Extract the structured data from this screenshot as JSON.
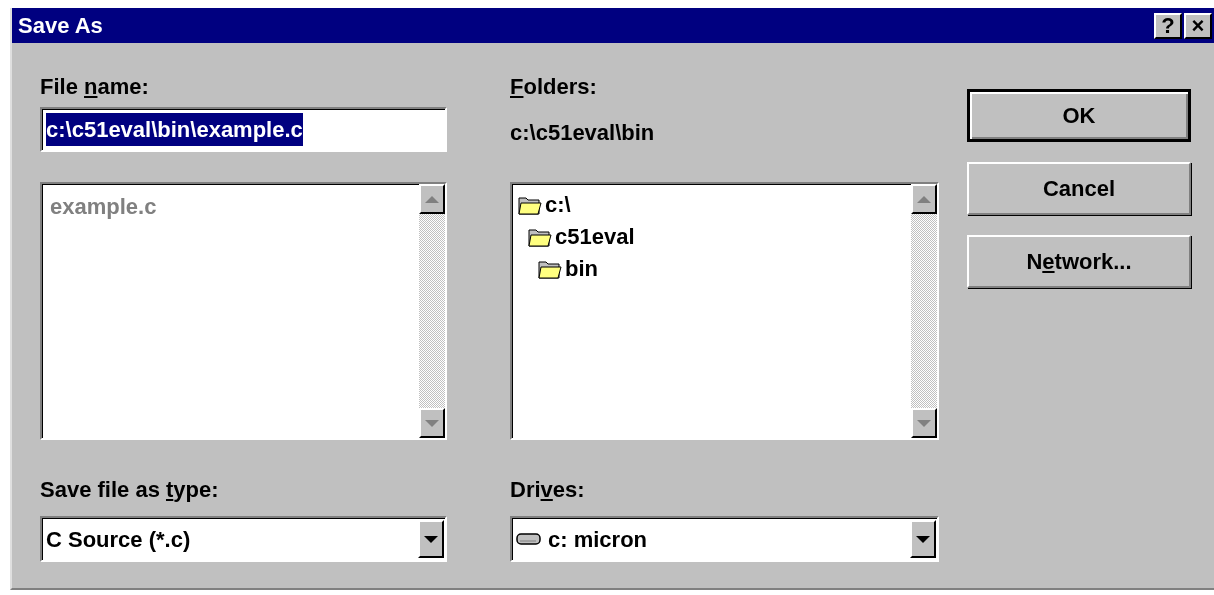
{
  "window": {
    "title": "Save As",
    "title_buttons": [
      "?",
      "×"
    ]
  },
  "file_name": {
    "label": {
      "before": "File ",
      "key": "n",
      "after": "ame:"
    },
    "value": "c:\\c51eval\\bin\\example.c",
    "value_selected": true
  },
  "file_list": {
    "items": [
      {
        "text": "example.c",
        "disabled": true
      }
    ]
  },
  "folders": {
    "label": {
      "key": "F",
      "after": "olders:"
    },
    "path": "c:\\c51eval\\bin",
    "tree": [
      {
        "name": "c:\\",
        "children": [
          {
            "name": "c51eval",
            "children": [
              {
                "name": "bin"
              }
            ]
          }
        ]
      }
    ]
  },
  "save_type": {
    "label": {
      "before": "Save file as ",
      "key": "t",
      "after": "ype:"
    },
    "value": "C Source (*.c)"
  },
  "drives": {
    "label": {
      "before": "Dri",
      "key": "v",
      "after": "es:"
    },
    "value": "c: micron"
  },
  "buttons": [
    {
      "label": {
        "before": "OK"
      },
      "default": true
    },
    {
      "label": {
        "before": "Cancel"
      },
      "default": false
    },
    {
      "label": {
        "before": "N",
        "key": "e",
        "after": "twork..."
      },
      "default": false
    }
  ]
}
